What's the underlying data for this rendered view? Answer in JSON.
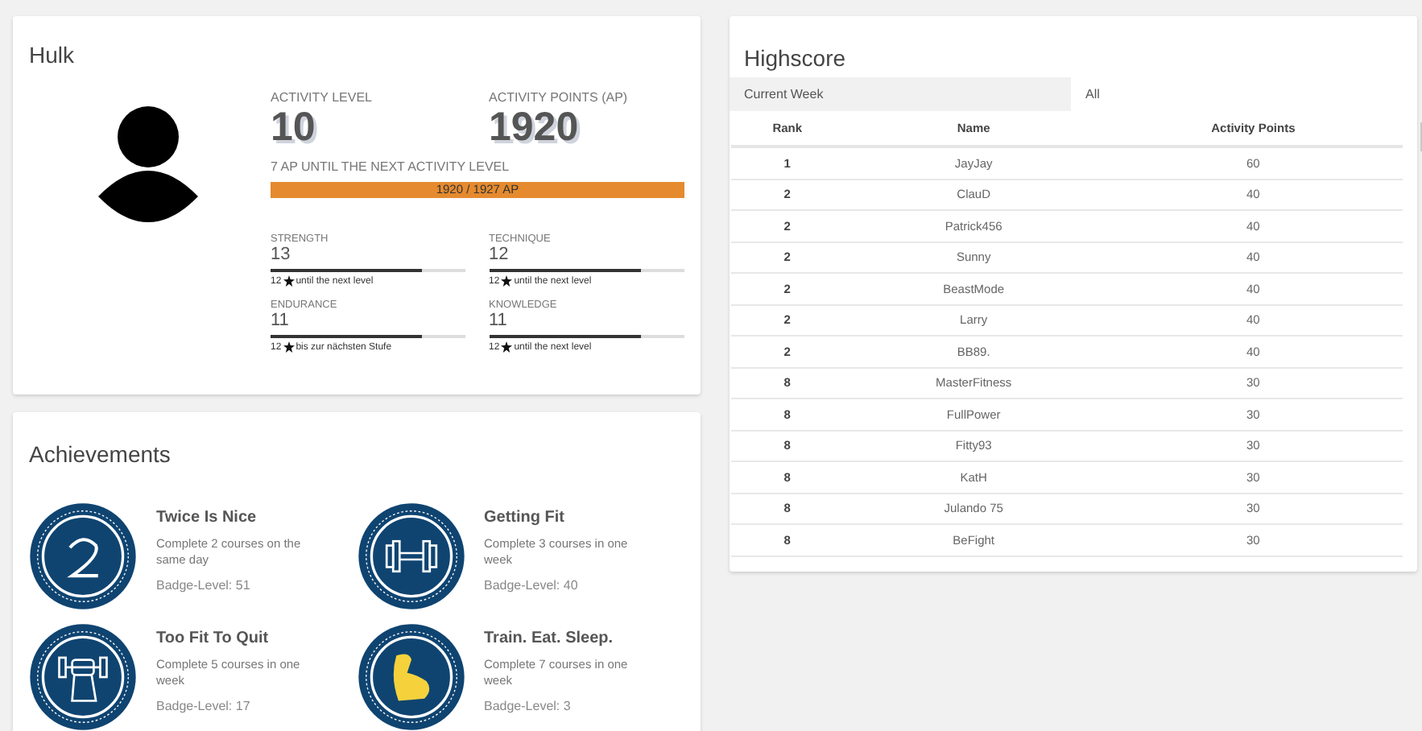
{
  "profile": {
    "name": "Hulk",
    "activity_level_label": "ACTIVITY LEVEL",
    "activity_level": "10",
    "activity_points_label": "ACTIVITY POINTS (AP)",
    "activity_points": "1920",
    "next_level_text": "7 AP UNTIL THE NEXT ACTIVITY LEVEL",
    "progress": {
      "level": 1.0,
      "text": "1920 / 1927 AP"
    },
    "stats": [
      {
        "label": "STRENGTH",
        "value": "13",
        "level": 0.78,
        "stars": "12",
        "hint": "until the next level"
      },
      {
        "label": "TECHNIQUE",
        "value": "12",
        "level": 0.78,
        "stars": "12",
        "hint": "until the next level"
      },
      {
        "label": "ENDURANCE",
        "value": "11",
        "level": 0.78,
        "stars": "12",
        "hint": "bis zur nächsten Stufe"
      },
      {
        "label": "KNOWLEDGE",
        "value": "11",
        "level": 0.78,
        "stars": "12",
        "hint": "until the next level"
      }
    ]
  },
  "achievements": {
    "title": "Achievements",
    "items": [
      {
        "kind": "two",
        "title": "Twice Is Nice",
        "description": "Complete 2 courses on the same day",
        "badge_level": "Badge-Level: 51"
      },
      {
        "kind": "dumbbell",
        "title": "Getting Fit",
        "description": "Complete 3 courses in one week",
        "badge_level": "Badge-Level: 40"
      },
      {
        "kind": "fist",
        "title": "Too Fit To Quit",
        "description": "Complete 5 courses in one week",
        "badge_level": "Badge-Level: 17"
      },
      {
        "kind": "arm",
        "title": "Train. Eat. Sleep.",
        "description": "Complete 7 courses in one week",
        "badge_level": "Badge-Level: 3"
      }
    ]
  },
  "highscore": {
    "title": "Highscore",
    "tabs": [
      {
        "label": "Current Week",
        "selected": true
      },
      {
        "label": "All",
        "selected": false
      }
    ],
    "columns": [
      "Rank",
      "Name",
      "Activity Points"
    ],
    "rows": [
      [
        "1",
        "JayJay",
        "60"
      ],
      [
        "2",
        "ClauD",
        "40"
      ],
      [
        "2",
        "Patrick456",
        "40"
      ],
      [
        "2",
        "Sunny",
        "40"
      ],
      [
        "2",
        "BeastMode",
        "40"
      ],
      [
        "2",
        "Larry",
        "40"
      ],
      [
        "2",
        "BB89.",
        "40"
      ],
      [
        "8",
        "MasterFitness",
        "30"
      ],
      [
        "8",
        "FullPower",
        "30"
      ],
      [
        "8",
        "Fitty93",
        "30"
      ],
      [
        "8",
        "KatH",
        "30"
      ],
      [
        "8",
        "Julando 75",
        "30"
      ],
      [
        "8",
        "BeFight",
        "30"
      ]
    ]
  }
}
